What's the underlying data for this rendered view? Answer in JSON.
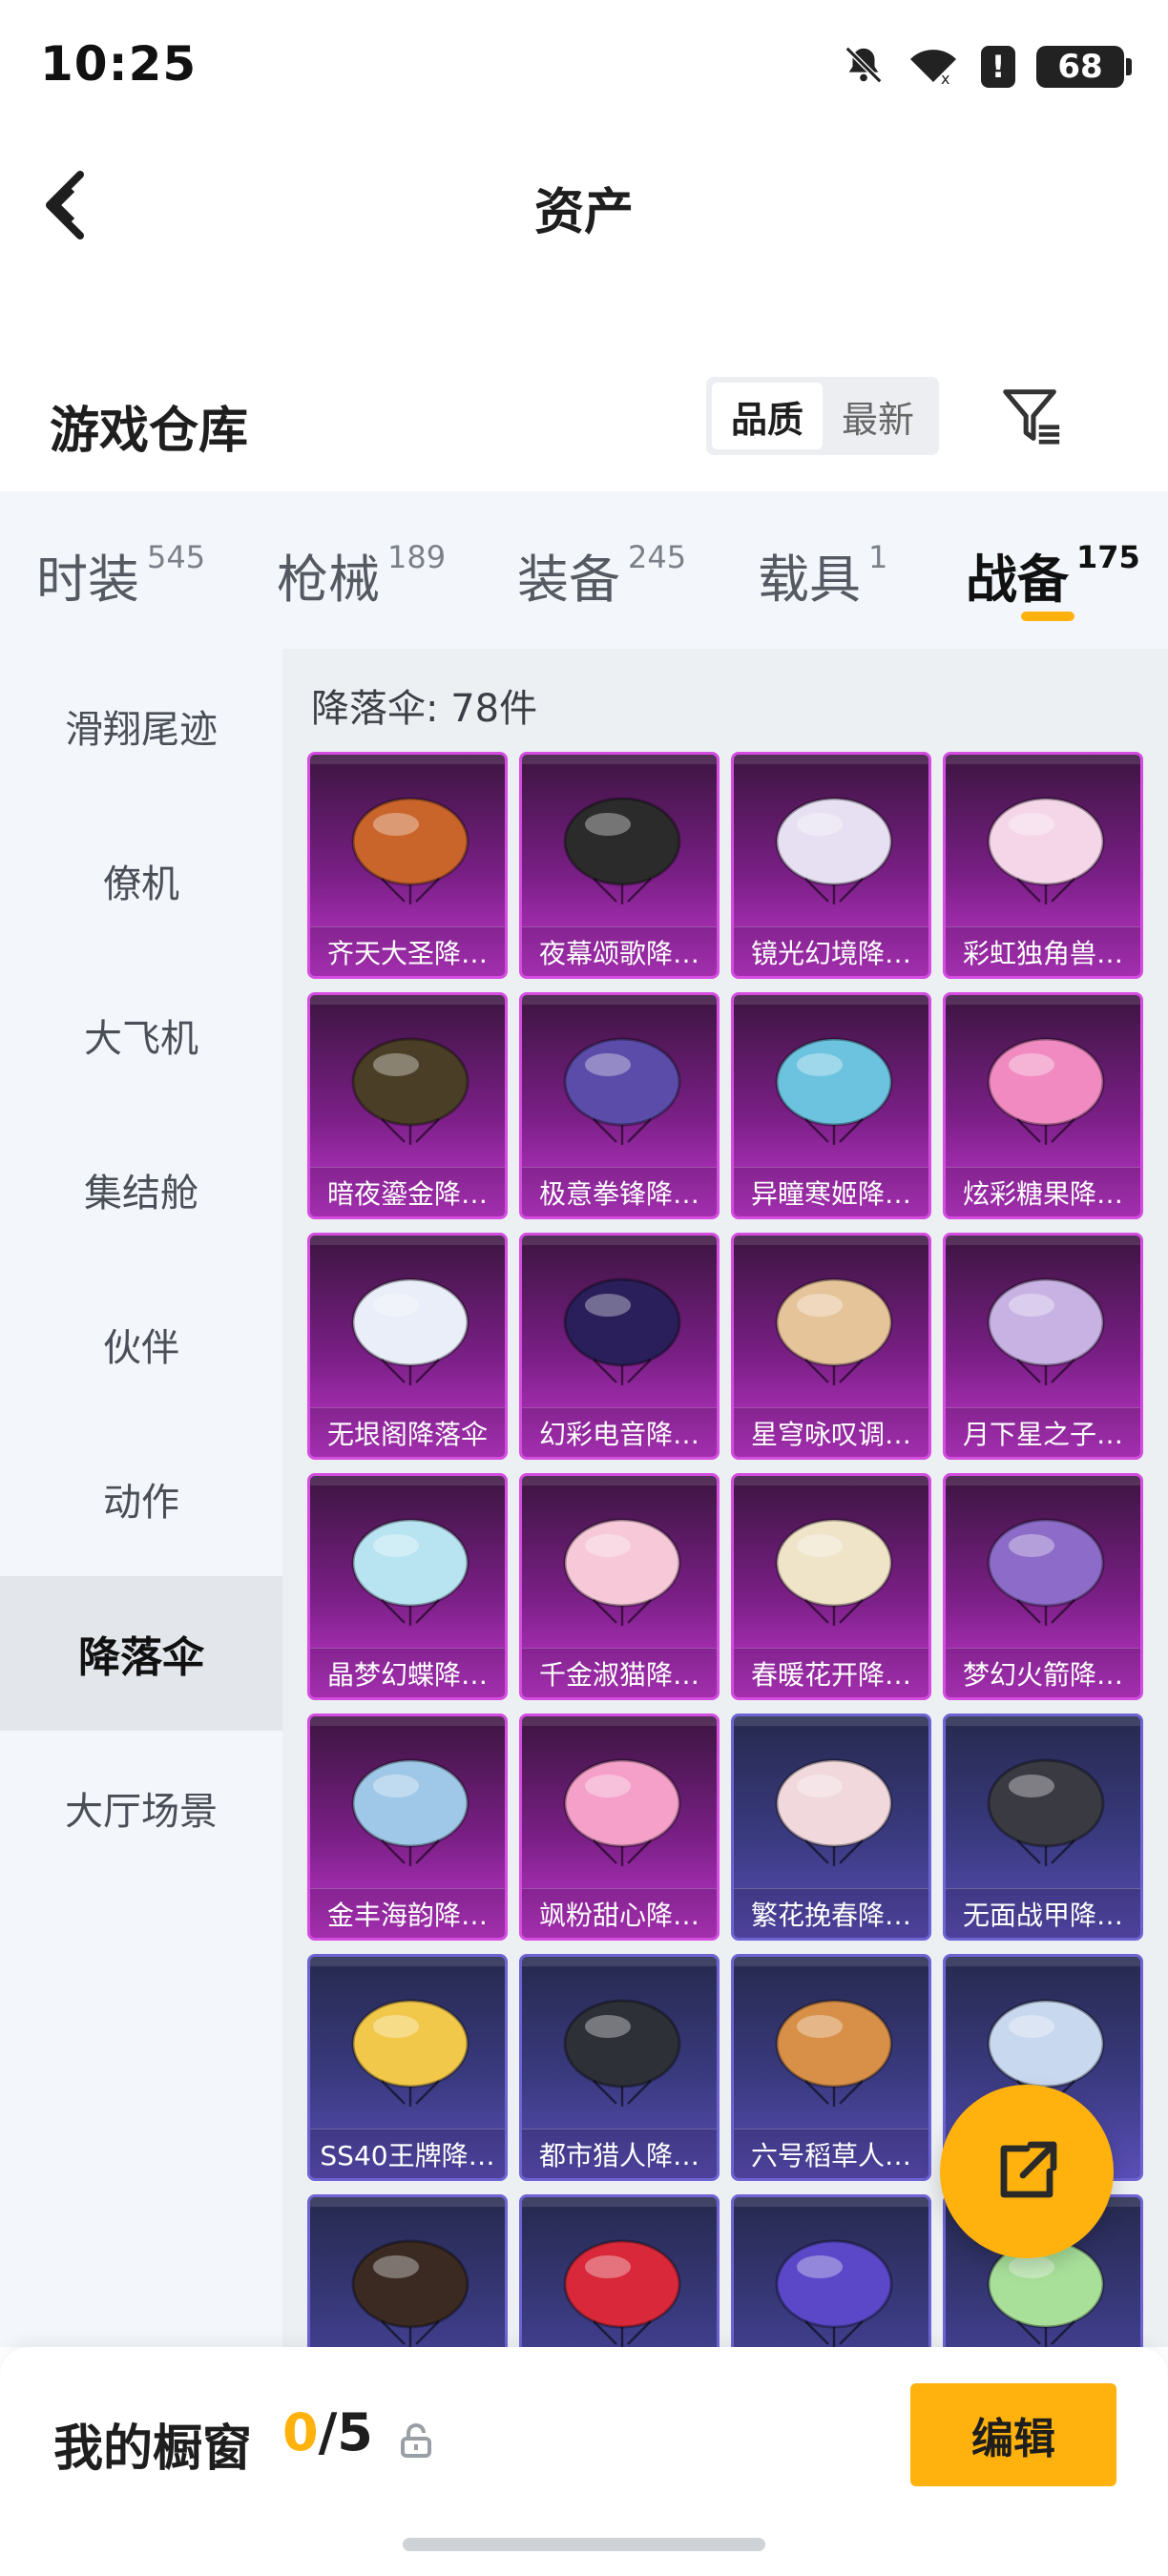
{
  "status_bar": {
    "time": "10:25",
    "battery": "68",
    "alert": "!"
  },
  "header": {
    "title": "资产"
  },
  "warehouse": {
    "title": "游戏仓库",
    "sort_options": [
      "品质",
      "最新"
    ]
  },
  "category_tabs": [
    {
      "label": "时装",
      "count": "545"
    },
    {
      "label": "枪械",
      "count": "189"
    },
    {
      "label": "装备",
      "count": "245"
    },
    {
      "label": "载具",
      "count": "1"
    },
    {
      "label": "战备",
      "count": "175"
    }
  ],
  "sidebar": {
    "items": [
      "滑翔尾迹",
      "僚机",
      "大飞机",
      "集结舱",
      "伙伴",
      "动作",
      "降落伞",
      "大厅场景"
    ],
    "active": "降落伞"
  },
  "content": {
    "count_label": "降落伞: 78件",
    "items": [
      {
        "name": "齐天大圣降…",
        "tier": "purple",
        "color": "#c9642a"
      },
      {
        "name": "夜幕颂歌降…",
        "tier": "purple",
        "color": "#2b2b2b"
      },
      {
        "name": "镜光幻境降…",
        "tier": "purple",
        "color": "#e6e0f2"
      },
      {
        "name": "彩虹独角兽…",
        "tier": "purple",
        "color": "#f5d6e8"
      },
      {
        "name": "暗夜鎏金降…",
        "tier": "purple",
        "color": "#4a3f26"
      },
      {
        "name": "极意拳锋降…",
        "tier": "purple",
        "color": "#5a4ca8"
      },
      {
        "name": "异瞳寒姬降…",
        "tier": "purple",
        "color": "#6cc3e0"
      },
      {
        "name": "炫彩糖果降…",
        "tier": "purple",
        "color": "#f08ac0"
      },
      {
        "name": "无垠阁降落伞",
        "tier": "purple",
        "color": "#e9eef8"
      },
      {
        "name": "幻彩电音降…",
        "tier": "purple",
        "color": "#2a1f5a"
      },
      {
        "name": "星穹咏叹调…",
        "tier": "purple",
        "color": "#e6c49a"
      },
      {
        "name": "月下星之子…",
        "tier": "purple",
        "color": "#c8b2e4"
      },
      {
        "name": "晶梦幻蝶降…",
        "tier": "purple",
        "color": "#b8e4f2"
      },
      {
        "name": "千金淑猫降…",
        "tier": "purple",
        "color": "#f6c8d8"
      },
      {
        "name": "春暖花开降…",
        "tier": "purple",
        "color": "#efe3c8"
      },
      {
        "name": "梦幻火箭降…",
        "tier": "purple",
        "color": "#8c6cc8"
      },
      {
        "name": "金丰海韵降…",
        "tier": "purple",
        "color": "#9fc8e8"
      },
      {
        "name": "飒粉甜心降…",
        "tier": "purple",
        "color": "#f4a0c8"
      },
      {
        "name": "繁花挽春降…",
        "tier": "blue",
        "color": "#f0d8dc"
      },
      {
        "name": "无面战甲降…",
        "tier": "blue",
        "color": "#3a3a42"
      },
      {
        "name": "SS40王牌降…",
        "tier": "blue",
        "color": "#f2c84a"
      },
      {
        "name": "都市猎人降…",
        "tier": "blue",
        "color": "#2e3038"
      },
      {
        "name": "六号稻草人…",
        "tier": "blue",
        "color": "#d89048"
      },
      {
        "name": "",
        "tier": "blue",
        "color": "#c8d8ee"
      },
      {
        "name": "",
        "tier": "blue",
        "color": "#3a2a22"
      },
      {
        "name": "",
        "tier": "blue",
        "color": "#d8283a"
      },
      {
        "name": "",
        "tier": "blue",
        "color": "#5a48c8"
      },
      {
        "name": "",
        "tier": "blue",
        "color": "#a8e09a"
      }
    ]
  },
  "showcase": {
    "label": "我的橱窗",
    "current": "0",
    "total": "/5",
    "edit_label": "编辑"
  },
  "colors": {
    "accent": "#ffb20d",
    "purple_tier": "#c238cf",
    "blue_tier": "#5a4fb8"
  }
}
